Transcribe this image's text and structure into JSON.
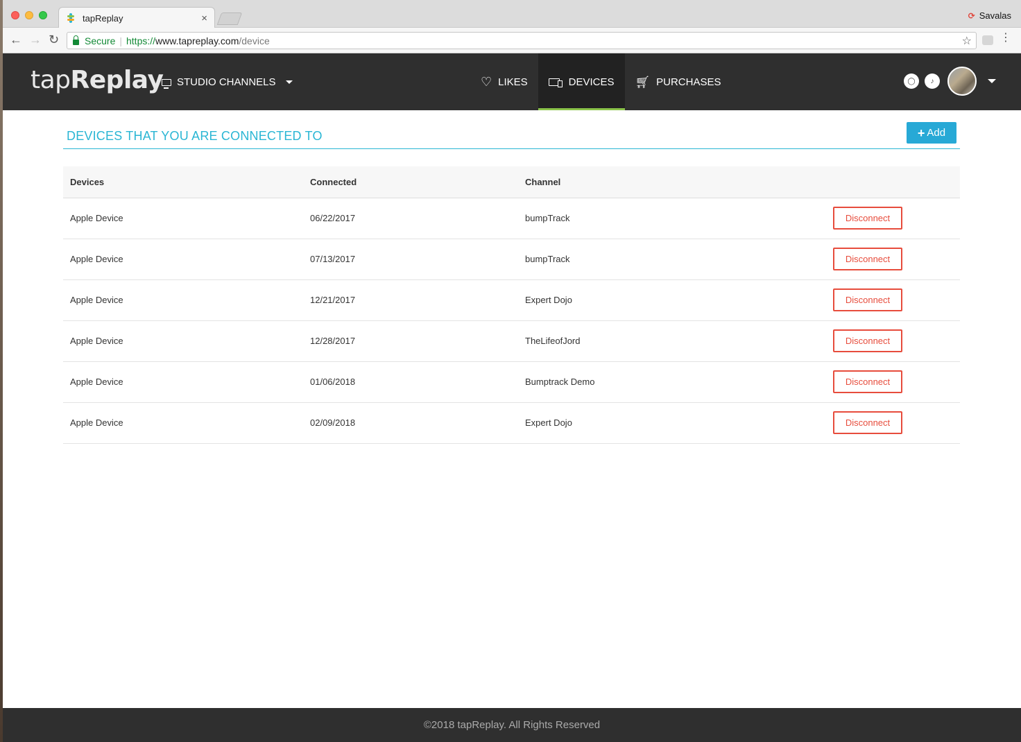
{
  "browser": {
    "tab_title": "tapReplay",
    "tab_close": "×",
    "profile_name": "Savalas",
    "secure_label": "Secure",
    "url_scheme": "https://",
    "url_host": "www.tapreplay.com",
    "url_path": "/device"
  },
  "header": {
    "logo_light": "tap",
    "logo_bold": "Replay",
    "studio_label": "STUDIO CHANNELS",
    "nav": [
      {
        "label": "LIKES",
        "icon": "heart-icon"
      },
      {
        "label": "DEVICES",
        "icon": "devices-icon",
        "active": true
      },
      {
        "label": "PURCHASES",
        "icon": "cart-icon"
      }
    ]
  },
  "page": {
    "title": "DEVICES THAT YOU ARE CONNECTED TO",
    "add_label": "Add"
  },
  "table": {
    "headers": [
      "Devices",
      "Connected",
      "Channel"
    ],
    "rows": [
      {
        "device": "Apple Device",
        "connected": "06/22/2017",
        "channel": "bumpTrack",
        "action": "Disconnect"
      },
      {
        "device": "Apple Device",
        "connected": "07/13/2017",
        "channel": "bumpTrack",
        "action": "Disconnect"
      },
      {
        "device": "Apple Device",
        "connected": "12/21/2017",
        "channel": "Expert Dojo",
        "action": "Disconnect"
      },
      {
        "device": "Apple Device",
        "connected": "12/28/2017",
        "channel": "TheLifeofJord",
        "action": "Disconnect"
      },
      {
        "device": "Apple Device",
        "connected": "01/06/2018",
        "channel": "Bumptrack Demo",
        "action": "Disconnect"
      },
      {
        "device": "Apple Device",
        "connected": "02/09/2018",
        "channel": "Expert Dojo",
        "action": "Disconnect"
      }
    ]
  },
  "footer": {
    "text": "©2018 tapReplay. All Rights Reserved"
  },
  "colors": {
    "accent": "#2ab6d4",
    "add_button": "#27a9d6",
    "danger": "#e74c3c",
    "header_bg": "#2f2f2f",
    "active_underline": "#8bc34a"
  }
}
